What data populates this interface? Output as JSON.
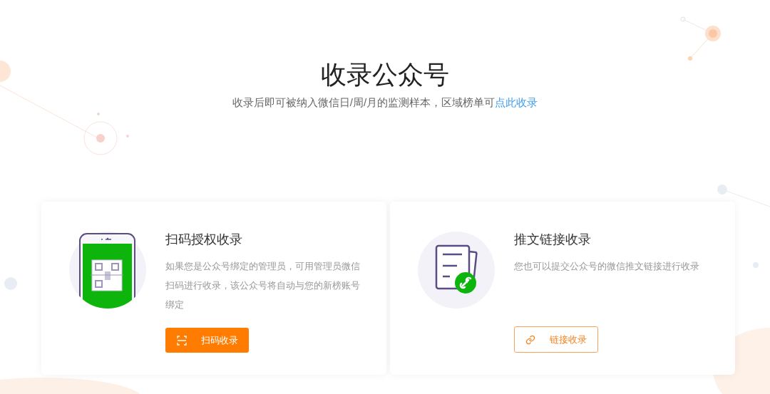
{
  "header": {
    "title": "收录公众号",
    "subtitle": "收录后即可被纳入微信日/周/月的监测样本，区域榜单可",
    "subtitle_link": "点此收录"
  },
  "methods": [
    {
      "kind": "qrcode",
      "title": "扫码授权收录",
      "description": "如果您是公众号绑定的管理员，可用管理员微信扫码进行收录，该公众号将自动与您的新榜账号绑定",
      "button": "扫码收录",
      "primary": true
    },
    {
      "kind": "link",
      "title": "推文链接收录",
      "description": "您也可以提交公众号的微信推文链接进行收录",
      "button": "链接收录",
      "primary": false
    }
  ]
}
